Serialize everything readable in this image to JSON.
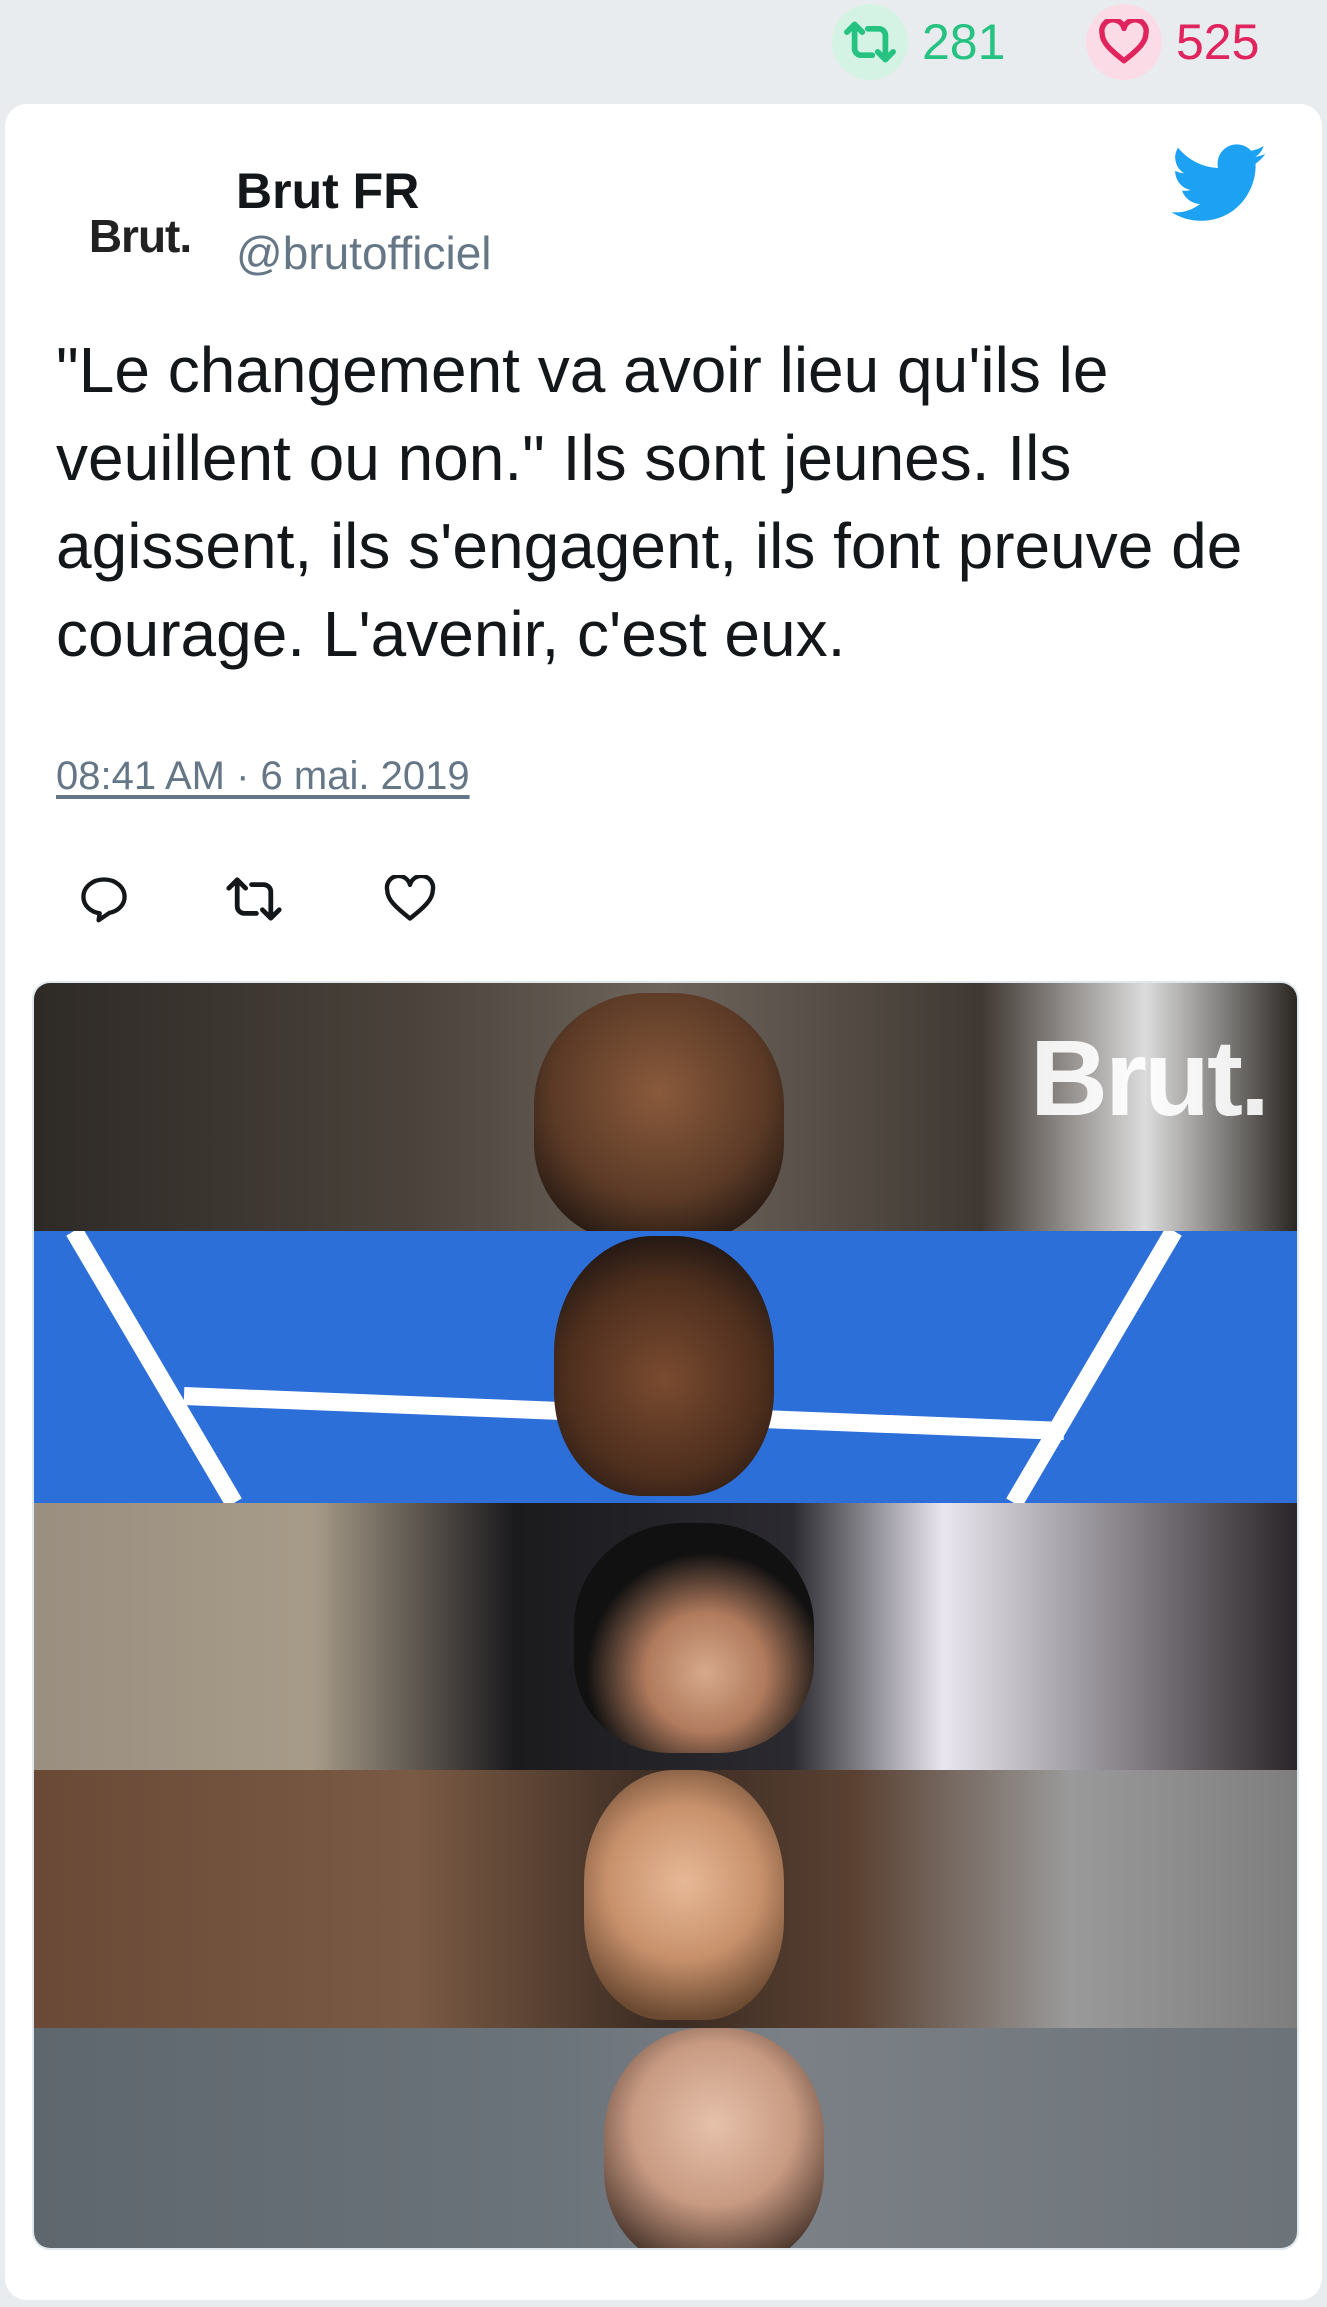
{
  "stats": {
    "retweets": "281",
    "likes": "525"
  },
  "tweet": {
    "avatar_text": "Brut.",
    "display_name": "Brut FR",
    "handle": "@brutofficiel",
    "text": "\"Le changement va avoir lieu qu'ils le veuillent ou non.\" Ils sont jeunes. Ils agissent, ils s'engagent, ils font preuve de courage. L'avenir, c'est eux.",
    "timestamp": "08:41 AM · 6 mai. 2019"
  },
  "media": {
    "watermark": "Brut."
  },
  "icons": {
    "retweet": "retweet-icon",
    "like": "heart-icon",
    "reply": "reply-icon",
    "brand": "twitter-bird-icon"
  },
  "colors": {
    "retweet": "#26c281",
    "like": "#e0245e",
    "twitter_blue": "#1da1f2",
    "handle_gray": "#657786"
  }
}
